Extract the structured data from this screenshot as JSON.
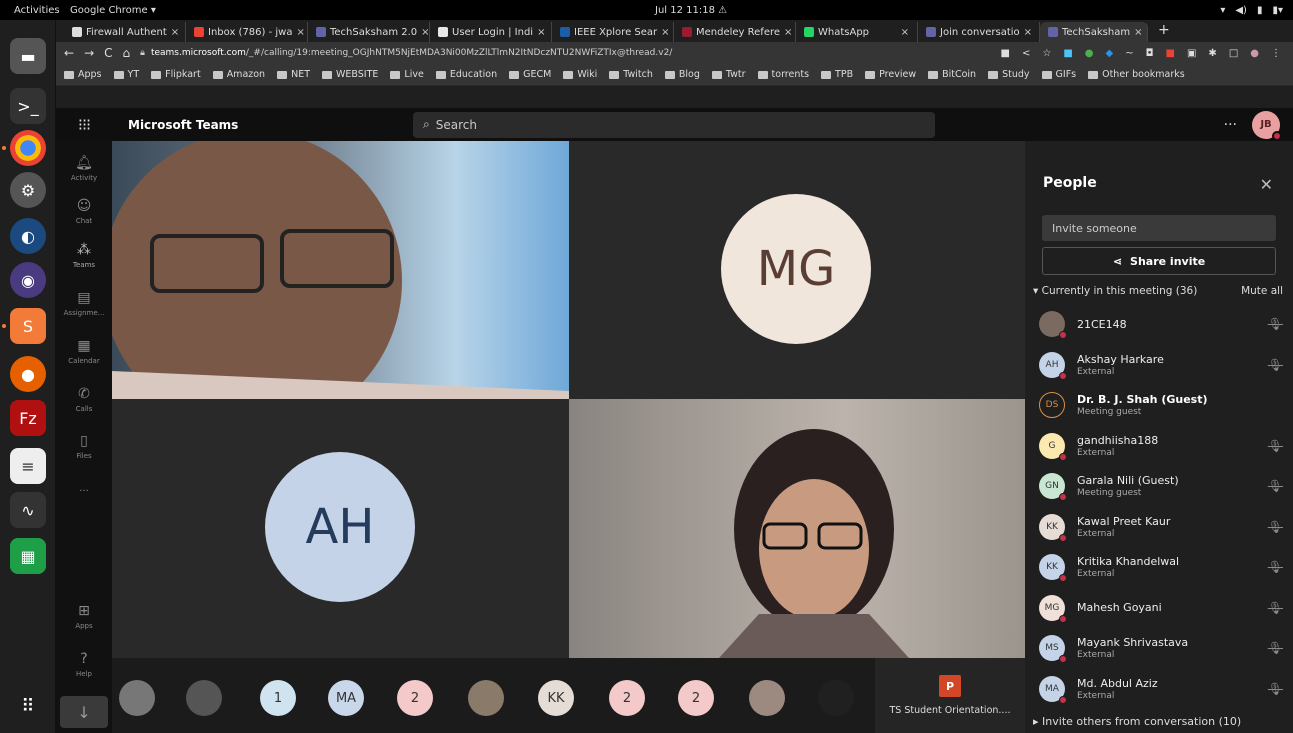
{
  "os": {
    "activities": "Activities",
    "app_menu": "Google Chrome ▾",
    "clock": "Jul 12  11:18"
  },
  "chrome": {
    "tabs": [
      {
        "label": "Firewall Authent",
        "icon_color": "#dddddd"
      },
      {
        "label": "Inbox (786) - jwa",
        "icon_color": "#ea4335"
      },
      {
        "label": "TechSaksham 2.0",
        "icon_color": "#6264a7"
      },
      {
        "label": "User Login | Indi",
        "icon_color": "#e8e8e8"
      },
      {
        "label": "IEEE Xplore Sear",
        "icon_color": "#1a5ea8"
      },
      {
        "label": "Mendeley Refere",
        "icon_color": "#9b1b30"
      },
      {
        "label": "WhatsApp",
        "icon_color": "#25d366"
      },
      {
        "label": "Join conversatio",
        "icon_color": "#6264a7"
      },
      {
        "label": "TechSaksham",
        "icon_color": "#6264a7",
        "active": true
      }
    ],
    "url_host": "teams.microsoft.com",
    "url_path": "/_#/calling/19:meeting_OGJhNTM5NjEtMDA3Ni00MzZlLTlmN2ItNDczNTU2NWFiZTIx@thread.v2/",
    "bookmarks": [
      "Apps",
      "YT",
      "Flipkart",
      "Amazon",
      "NET",
      "WEBSITE",
      "Live",
      "Education",
      "GECM",
      "Wiki",
      "Twitch",
      "Blog",
      "Twtr",
      "torrents",
      "TPB",
      "Preview",
      "BitCoin",
      "Study",
      "GIFs",
      "Other bookmarks"
    ]
  },
  "teams": {
    "app_name": "Microsoft Teams",
    "search_placeholder": "Search",
    "user_initials": "JB",
    "rail": [
      "Activity",
      "Chat",
      "Teams",
      "Assignme...",
      "Calendar",
      "Calls",
      "Files",
      "Apps",
      "Help"
    ],
    "rail_more": "...",
    "video_tiles": [
      {
        "initials": "MG",
        "bg": "#f0e6dc",
        "fg": "#5a3e34"
      },
      {
        "initials": "AH",
        "bg": "#c5d3e8",
        "fg": "#253b5c"
      }
    ],
    "strip": [
      {
        "label": "",
        "bg": "#777777",
        "kind": "photo"
      },
      {
        "label": "",
        "bg": "#555555",
        "kind": "photo"
      },
      {
        "label": "1",
        "bg": "#cfe3f0",
        "kind": "count"
      },
      {
        "label": "MA",
        "bg": "#c8d8ea",
        "kind": "initials"
      },
      {
        "label": "2",
        "bg": "#f4c9c9",
        "kind": "count"
      },
      {
        "label": "",
        "bg": "#8a7a6a",
        "kind": "photo"
      },
      {
        "label": "KK",
        "bg": "#e6dcd6",
        "kind": "initials"
      },
      {
        "label": "2",
        "bg": "#f4c9c9",
        "kind": "count"
      },
      {
        "label": "2",
        "bg": "#f4c9c9",
        "kind": "count"
      },
      {
        "label": "",
        "bg": "#9c8a80",
        "kind": "photo"
      },
      {
        "label": "",
        "bg": "#202020",
        "kind": "photo"
      }
    ],
    "shared_file": "TS Student Orientation....",
    "ppt_letter": "P"
  },
  "panel": {
    "title": "People",
    "invite_placeholder": "Invite someone",
    "share_invite": "Share invite",
    "section": "Currently in this meeting (36)",
    "mute_all": "Mute all",
    "people": [
      {
        "initials": "",
        "name": "21CE148",
        "sub": "",
        "bg": "#7a6a60",
        "bold": false,
        "mic": true
      },
      {
        "initials": "AH",
        "name": "Akshay Harkare",
        "sub": "External",
        "bg": "#c5d3e8",
        "bold": false,
        "mic": true
      },
      {
        "initials": "DS",
        "name": "Dr. B. J. Shah (Guest)",
        "sub": "Meeting guest",
        "bg": "#fbe6c8",
        "bold": true,
        "mic": false
      },
      {
        "initials": "G",
        "name": "gandhiisha188",
        "sub": "External",
        "bg": "#fbe9b0",
        "bold": false,
        "mic": true
      },
      {
        "initials": "GN",
        "name": "Garala Nili (Guest)",
        "sub": "Meeting guest",
        "bg": "#c8e6d2",
        "bold": false,
        "mic": true
      },
      {
        "initials": "KK",
        "name": "Kawal Preet Kaur",
        "sub": "External",
        "bg": "#e6dcd6",
        "bold": false,
        "mic": true
      },
      {
        "initials": "KK",
        "name": "Kritika Khandelwal",
        "sub": "External",
        "bg": "#c5d3e8",
        "bold": false,
        "mic": true
      },
      {
        "initials": "MG",
        "name": "Mahesh Goyani",
        "sub": "",
        "bg": "#efe0da",
        "bold": false,
        "mic": true
      },
      {
        "initials": "MS",
        "name": "Mayank Shrivastava",
        "sub": "External",
        "bg": "#c5d3e8",
        "bold": false,
        "mic": true
      },
      {
        "initials": "MA",
        "name": "Md. Abdul Aziz",
        "sub": "External",
        "bg": "#c5d3e8",
        "bold": false,
        "mic": true
      }
    ],
    "invite_others": "Invite others from conversation (10)"
  }
}
